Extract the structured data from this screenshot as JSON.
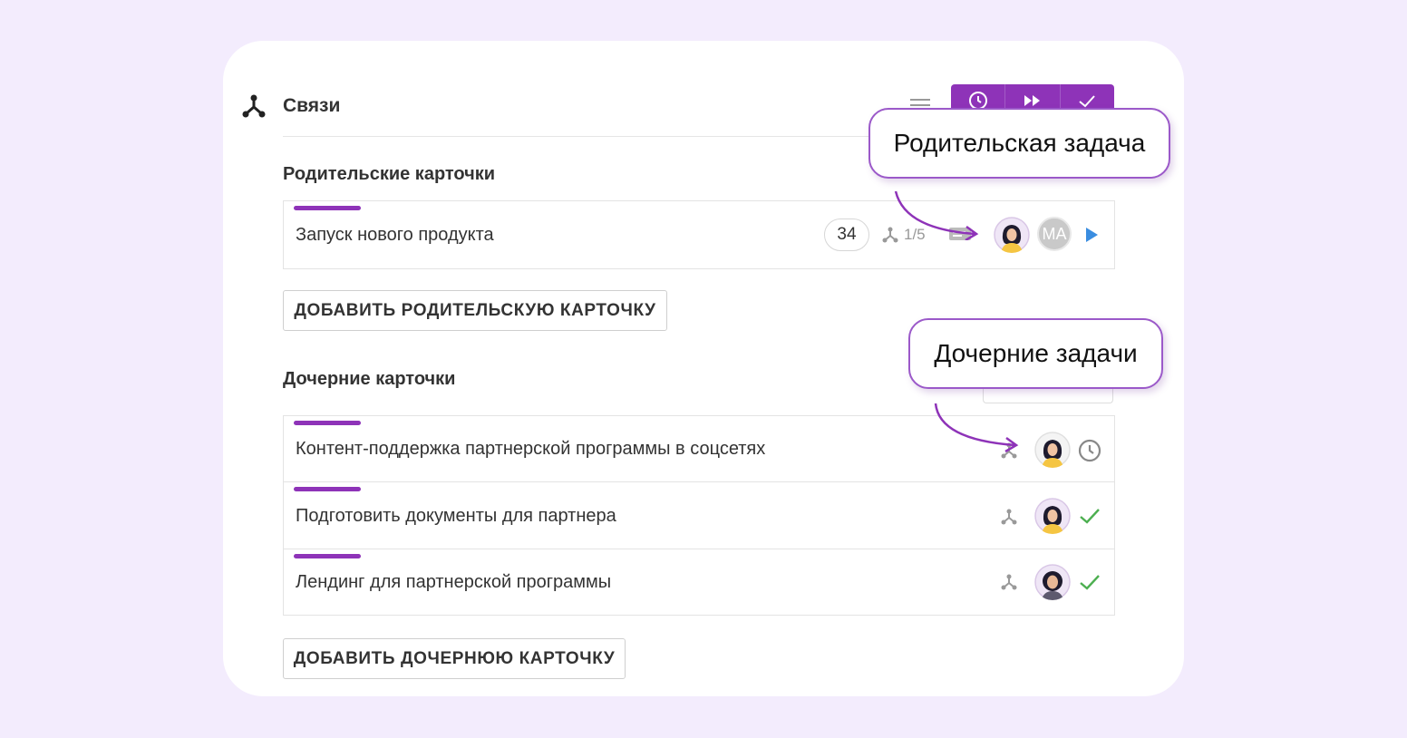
{
  "header": {
    "title": "Связи",
    "icon": "relations-icon",
    "toolbar": [
      {
        "name": "clock-icon"
      },
      {
        "name": "fast-forward-icon"
      },
      {
        "name": "check-icon"
      }
    ],
    "accent_color": "#8e33b8"
  },
  "parents": {
    "section_title": "Родительские карточки",
    "cards": [
      {
        "title": "Запуск нового продукта",
        "count": "34",
        "subtasks": "1/5",
        "avatar_initials": "MA"
      }
    ],
    "add_button": "ДОБАВИТЬ РОДИТЕЛЬСКУЮ КАРТОЧКУ"
  },
  "children": {
    "section_title": "Дочерние карточки",
    "cards": [
      {
        "title": "Контент-поддержка партнерской программы в соцсетях",
        "status": "clock-icon"
      },
      {
        "title": "Подготовить документы для партнера",
        "status": "check-icon"
      },
      {
        "title": "Лендинг для партнерской программы",
        "status": "check-icon"
      }
    ],
    "add_button": "ДОБАВИТЬ ДОЧЕРНЮЮ КАРТОЧКУ"
  },
  "callouts": {
    "parent": "Родительская задача",
    "children": "Дочерние задачи"
  },
  "colors": {
    "background": "#f3ecfd",
    "accent": "#8e33b8",
    "check": "#4caf50",
    "play": "#3a8de0"
  }
}
